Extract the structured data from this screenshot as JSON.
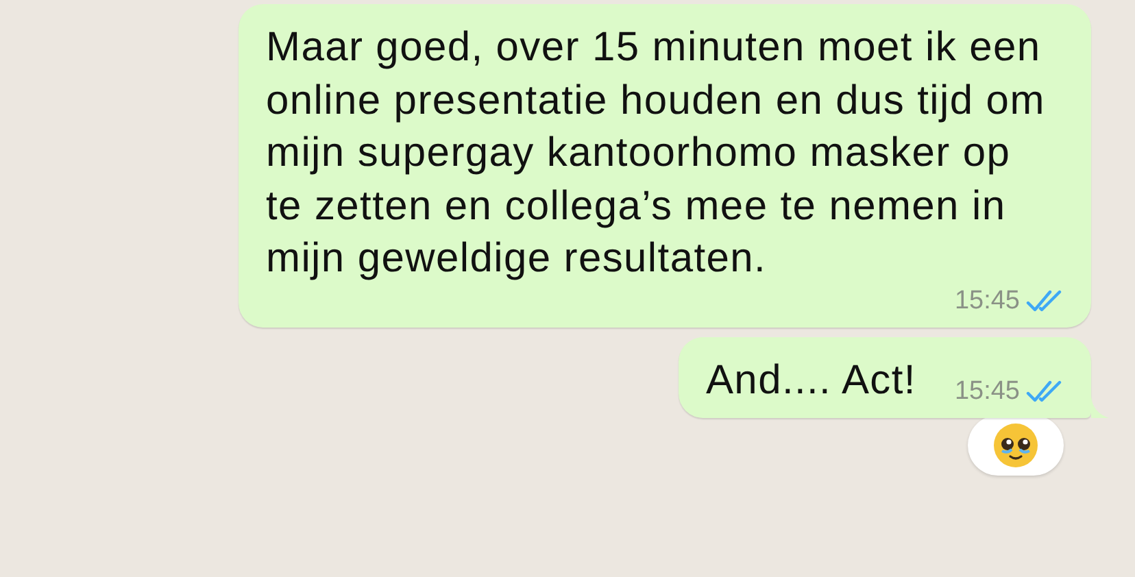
{
  "messages": [
    {
      "text": "Maar goed, over 15 minuten moet ik een online presentatie houden en dus tijd om mijn supergay kantoorhomo masker op te zetten en collega’s mee te nemen in mijn geweldige resultaten.",
      "time": "15:45",
      "read": true,
      "tail": false,
      "reacted": false
    },
    {
      "text": "And.... Act!",
      "time": "15:45",
      "read": true,
      "tail": true,
      "reacted": true
    }
  ]
}
